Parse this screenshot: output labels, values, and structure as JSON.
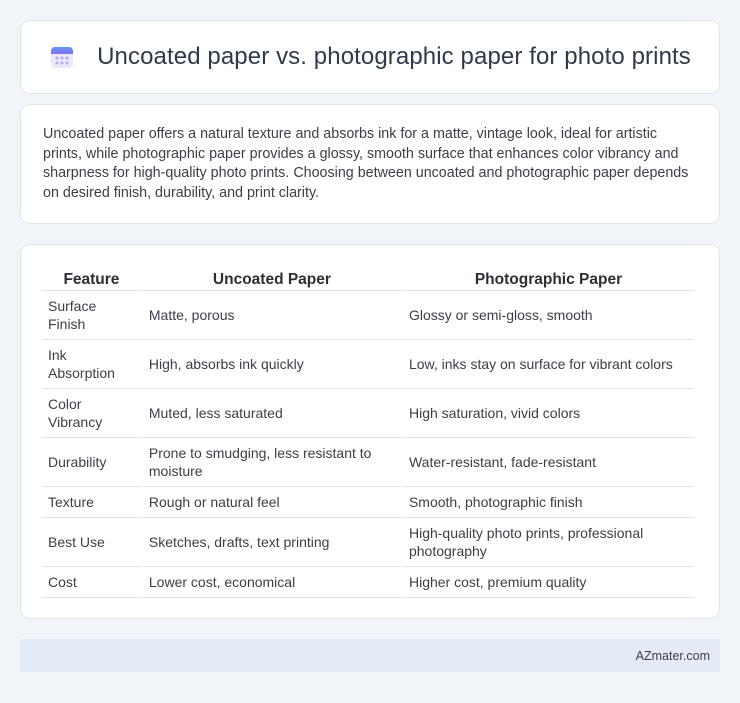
{
  "header": {
    "icon": "calendar-icon",
    "title": "Uncoated paper vs. photographic paper for photo prints"
  },
  "intro": {
    "text": "Uncoated paper offers a natural texture and absorbs ink for a matte, vintage look, ideal for artistic prints, while photographic paper provides a glossy, smooth surface that enhances color vibrancy and sharpness for high-quality photo prints. Choosing between uncoated and photographic paper depends on desired finish, durability, and print clarity."
  },
  "table": {
    "headers": [
      "Feature",
      "Uncoated Paper",
      "Photographic Paper"
    ],
    "rows": [
      [
        "Surface Finish",
        "Matte, porous",
        "Glossy or semi-gloss, smooth"
      ],
      [
        "Ink Absorption",
        "High, absorbs ink quickly",
        "Low, inks stay on surface for vibrant colors"
      ],
      [
        "Color Vibrancy",
        "Muted, less saturated",
        "High saturation, vivid colors"
      ],
      [
        "Durability",
        "Prone to smudging, less resistant to moisture",
        "Water-resistant, fade-resistant"
      ],
      [
        "Texture",
        "Rough or natural feel",
        "Smooth, photographic finish"
      ],
      [
        "Best Use",
        "Sketches, drafts, text printing",
        "High-quality photo prints, professional photography"
      ],
      [
        "Cost",
        "Lower cost, economical",
        "Higher cost, premium quality"
      ]
    ]
  },
  "footer": {
    "site": "AZmater.com"
  },
  "colors": {
    "background": "#f1f4f9",
    "card": "#ffffff",
    "footer_bar": "#e5ebf6",
    "icon_accent": "#7b6cf0"
  }
}
